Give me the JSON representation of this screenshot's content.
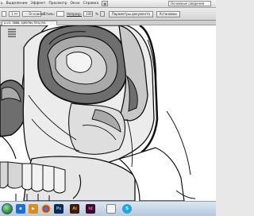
{
  "menubar": {
    "items": [
      "ь",
      "Выделение",
      "Эффект",
      "Просмотр",
      "Окно",
      "Справка"
    ],
    "workspace": "Основные сведения",
    "workspace_icon": "layout-icon"
  },
  "controlbar": {
    "stroke_weight": "1 пт",
    "stroke_profile": "— Основной",
    "style_label": "Стиль:",
    "opacity_label": "Непрозр.",
    "opacity_value": "100",
    "opacity_unit": "%",
    "doc_settings_button": "Параметры документа",
    "preferences_button": "Установки"
  },
  "document": {
    "tab_label": "Li с3. 3888, 4(8976з,75%) RG"
  },
  "colors": {
    "skull_dark": "#6e6e6e",
    "skull_mid": "#a9a9a9",
    "skull_light": "#d6d6d6",
    "outline": "#111111",
    "taskbar": "#c4d4e6"
  },
  "taskbar": {
    "apps": [
      {
        "icon": "windows-start-icon"
      },
      {
        "icon": "ie-browser-icon"
      },
      {
        "icon": "media-player-icon"
      },
      {
        "icon": "chrome-browser-icon"
      },
      {
        "icon": "photoshop-icon",
        "label": "Ps"
      },
      {
        "icon": "illustrator-icon",
        "label": "Ai"
      },
      {
        "icon": "indesign-icon",
        "label": "Id"
      },
      {
        "icon": "paint-icon"
      },
      {
        "icon": "skype-icon"
      }
    ]
  }
}
